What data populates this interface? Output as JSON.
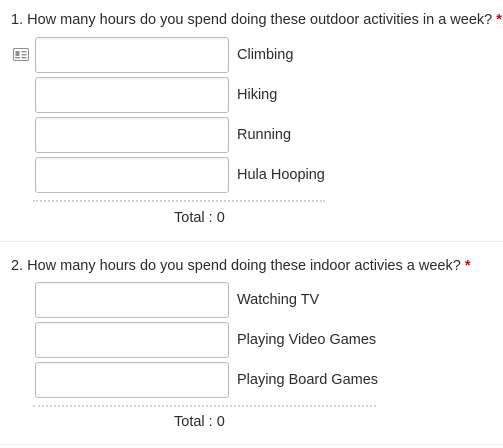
{
  "questions": [
    {
      "title": "1. How many hours do you spend doing these outdoor activities in a week?",
      "required_marker": "*",
      "rows": [
        {
          "label": "Climbing",
          "value": ""
        },
        {
          "label": "Hiking",
          "value": ""
        },
        {
          "label": "Running",
          "value": ""
        },
        {
          "label": "Hula Hooping",
          "value": ""
        }
      ],
      "total_label": "Total :",
      "total_value": "0"
    },
    {
      "title": "2. How many hours do you spend doing these indoor activies a week?",
      "required_marker": "*",
      "rows": [
        {
          "label": "Watching TV",
          "value": ""
        },
        {
          "label": "Playing Video Games",
          "value": ""
        },
        {
          "label": "Playing Board Games",
          "value": ""
        }
      ],
      "total_label": "Total :",
      "total_value": "0"
    }
  ],
  "icons": {
    "autofill": "contact-card-icon"
  }
}
